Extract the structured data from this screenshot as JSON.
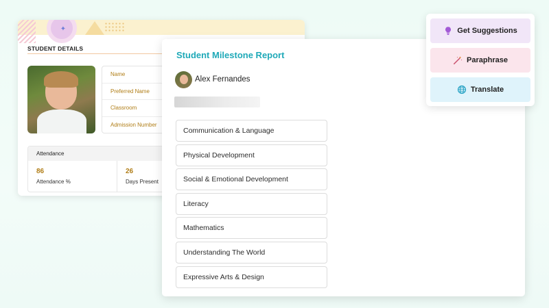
{
  "student_details": {
    "title": "STUDENT DETAILS",
    "fields": [
      "Name",
      "Preferred Name",
      "Classroom",
      "Admission Number"
    ],
    "attendance": {
      "header": "Attendance",
      "stats": [
        {
          "value": "86",
          "label": "Attendance %"
        },
        {
          "value": "26",
          "label": "Days Present"
        }
      ]
    }
  },
  "report": {
    "title": "Student Milestone Report",
    "student_name": "Alex Fernandes",
    "areas": [
      "Communication & Language",
      "Physical Development",
      "Social & Emotional Development",
      "Literacy",
      "Mathematics",
      "Understanding The World",
      "Expressive Arts & Design"
    ]
  },
  "actions": {
    "get_suggestions": "Get Suggestions",
    "paraphrase": "Paraphrase",
    "translate": "Translate"
  },
  "icons": {
    "get_suggestions": "lightbulb-icon",
    "paraphrase": "magic-wand-icon",
    "translate": "globe-icon"
  },
  "colors": {
    "accent_teal": "#1fa9b8",
    "field_label_gold": "#b07d16",
    "suggest_bg": "#f1e6f8",
    "paraphrase_bg": "#fbe5ec",
    "translate_bg": "#dff3fb"
  }
}
